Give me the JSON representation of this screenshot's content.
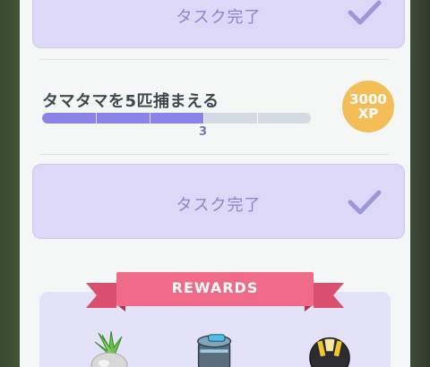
{
  "task_cards": [
    {
      "label": "タスク完了"
    },
    {
      "label": "タスク完了"
    }
  ],
  "task": {
    "title": "タマタマを5匹捕まえる",
    "progress_current": 3,
    "progress_total": 5,
    "progress_text": "3"
  },
  "xp_badge": {
    "amount": "3000",
    "unit": "XP"
  },
  "rewards": {
    "banner_label": "REWARDS",
    "items": [
      "exeggcute-icon",
      "potion-icon",
      "ultra-ball-icon"
    ]
  },
  "colors": {
    "accent_purple": "#8b84e8",
    "xp_gold": "#f3bd58",
    "ribbon_pink": "#ef6b88",
    "card_lavender": "#ddd8f7"
  }
}
